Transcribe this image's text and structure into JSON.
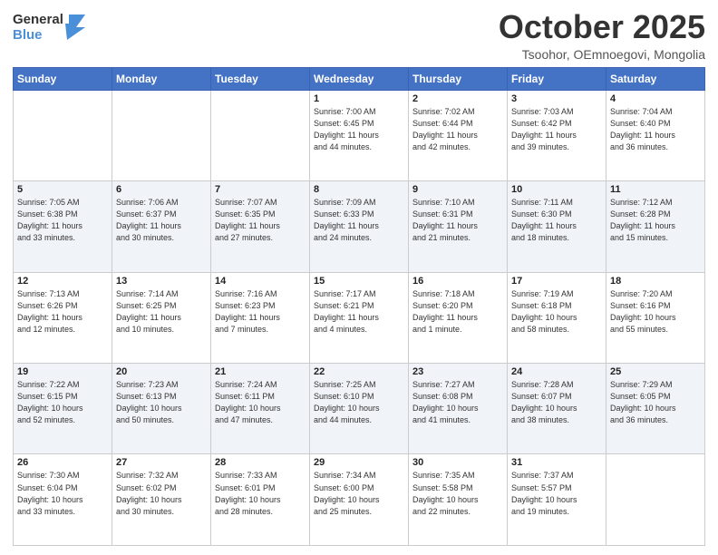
{
  "header": {
    "logo": {
      "general": "General",
      "blue": "Blue"
    },
    "title": "October 2025",
    "subtitle": "Tsoohor, OEmnoegovi, Mongolia"
  },
  "weekdays": [
    "Sunday",
    "Monday",
    "Tuesday",
    "Wednesday",
    "Thursday",
    "Friday",
    "Saturday"
  ],
  "weeks": [
    [
      {
        "day": "",
        "info": ""
      },
      {
        "day": "",
        "info": ""
      },
      {
        "day": "",
        "info": ""
      },
      {
        "day": "1",
        "info": "Sunrise: 7:00 AM\nSunset: 6:45 PM\nDaylight: 11 hours\nand 44 minutes."
      },
      {
        "day": "2",
        "info": "Sunrise: 7:02 AM\nSunset: 6:44 PM\nDaylight: 11 hours\nand 42 minutes."
      },
      {
        "day": "3",
        "info": "Sunrise: 7:03 AM\nSunset: 6:42 PM\nDaylight: 11 hours\nand 39 minutes."
      },
      {
        "day": "4",
        "info": "Sunrise: 7:04 AM\nSunset: 6:40 PM\nDaylight: 11 hours\nand 36 minutes."
      }
    ],
    [
      {
        "day": "5",
        "info": "Sunrise: 7:05 AM\nSunset: 6:38 PM\nDaylight: 11 hours\nand 33 minutes."
      },
      {
        "day": "6",
        "info": "Sunrise: 7:06 AM\nSunset: 6:37 PM\nDaylight: 11 hours\nand 30 minutes."
      },
      {
        "day": "7",
        "info": "Sunrise: 7:07 AM\nSunset: 6:35 PM\nDaylight: 11 hours\nand 27 minutes."
      },
      {
        "day": "8",
        "info": "Sunrise: 7:09 AM\nSunset: 6:33 PM\nDaylight: 11 hours\nand 24 minutes."
      },
      {
        "day": "9",
        "info": "Sunrise: 7:10 AM\nSunset: 6:31 PM\nDaylight: 11 hours\nand 21 minutes."
      },
      {
        "day": "10",
        "info": "Sunrise: 7:11 AM\nSunset: 6:30 PM\nDaylight: 11 hours\nand 18 minutes."
      },
      {
        "day": "11",
        "info": "Sunrise: 7:12 AM\nSunset: 6:28 PM\nDaylight: 11 hours\nand 15 minutes."
      }
    ],
    [
      {
        "day": "12",
        "info": "Sunrise: 7:13 AM\nSunset: 6:26 PM\nDaylight: 11 hours\nand 12 minutes."
      },
      {
        "day": "13",
        "info": "Sunrise: 7:14 AM\nSunset: 6:25 PM\nDaylight: 11 hours\nand 10 minutes."
      },
      {
        "day": "14",
        "info": "Sunrise: 7:16 AM\nSunset: 6:23 PM\nDaylight: 11 hours\nand 7 minutes."
      },
      {
        "day": "15",
        "info": "Sunrise: 7:17 AM\nSunset: 6:21 PM\nDaylight: 11 hours\nand 4 minutes."
      },
      {
        "day": "16",
        "info": "Sunrise: 7:18 AM\nSunset: 6:20 PM\nDaylight: 11 hours\nand 1 minute."
      },
      {
        "day": "17",
        "info": "Sunrise: 7:19 AM\nSunset: 6:18 PM\nDaylight: 10 hours\nand 58 minutes."
      },
      {
        "day": "18",
        "info": "Sunrise: 7:20 AM\nSunset: 6:16 PM\nDaylight: 10 hours\nand 55 minutes."
      }
    ],
    [
      {
        "day": "19",
        "info": "Sunrise: 7:22 AM\nSunset: 6:15 PM\nDaylight: 10 hours\nand 52 minutes."
      },
      {
        "day": "20",
        "info": "Sunrise: 7:23 AM\nSunset: 6:13 PM\nDaylight: 10 hours\nand 50 minutes."
      },
      {
        "day": "21",
        "info": "Sunrise: 7:24 AM\nSunset: 6:11 PM\nDaylight: 10 hours\nand 47 minutes."
      },
      {
        "day": "22",
        "info": "Sunrise: 7:25 AM\nSunset: 6:10 PM\nDaylight: 10 hours\nand 44 minutes."
      },
      {
        "day": "23",
        "info": "Sunrise: 7:27 AM\nSunset: 6:08 PM\nDaylight: 10 hours\nand 41 minutes."
      },
      {
        "day": "24",
        "info": "Sunrise: 7:28 AM\nSunset: 6:07 PM\nDaylight: 10 hours\nand 38 minutes."
      },
      {
        "day": "25",
        "info": "Sunrise: 7:29 AM\nSunset: 6:05 PM\nDaylight: 10 hours\nand 36 minutes."
      }
    ],
    [
      {
        "day": "26",
        "info": "Sunrise: 7:30 AM\nSunset: 6:04 PM\nDaylight: 10 hours\nand 33 minutes."
      },
      {
        "day": "27",
        "info": "Sunrise: 7:32 AM\nSunset: 6:02 PM\nDaylight: 10 hours\nand 30 minutes."
      },
      {
        "day": "28",
        "info": "Sunrise: 7:33 AM\nSunset: 6:01 PM\nDaylight: 10 hours\nand 28 minutes."
      },
      {
        "day": "29",
        "info": "Sunrise: 7:34 AM\nSunset: 6:00 PM\nDaylight: 10 hours\nand 25 minutes."
      },
      {
        "day": "30",
        "info": "Sunrise: 7:35 AM\nSunset: 5:58 PM\nDaylight: 10 hours\nand 22 minutes."
      },
      {
        "day": "31",
        "info": "Sunrise: 7:37 AM\nSunset: 5:57 PM\nDaylight: 10 hours\nand 19 minutes."
      },
      {
        "day": "",
        "info": ""
      }
    ]
  ]
}
